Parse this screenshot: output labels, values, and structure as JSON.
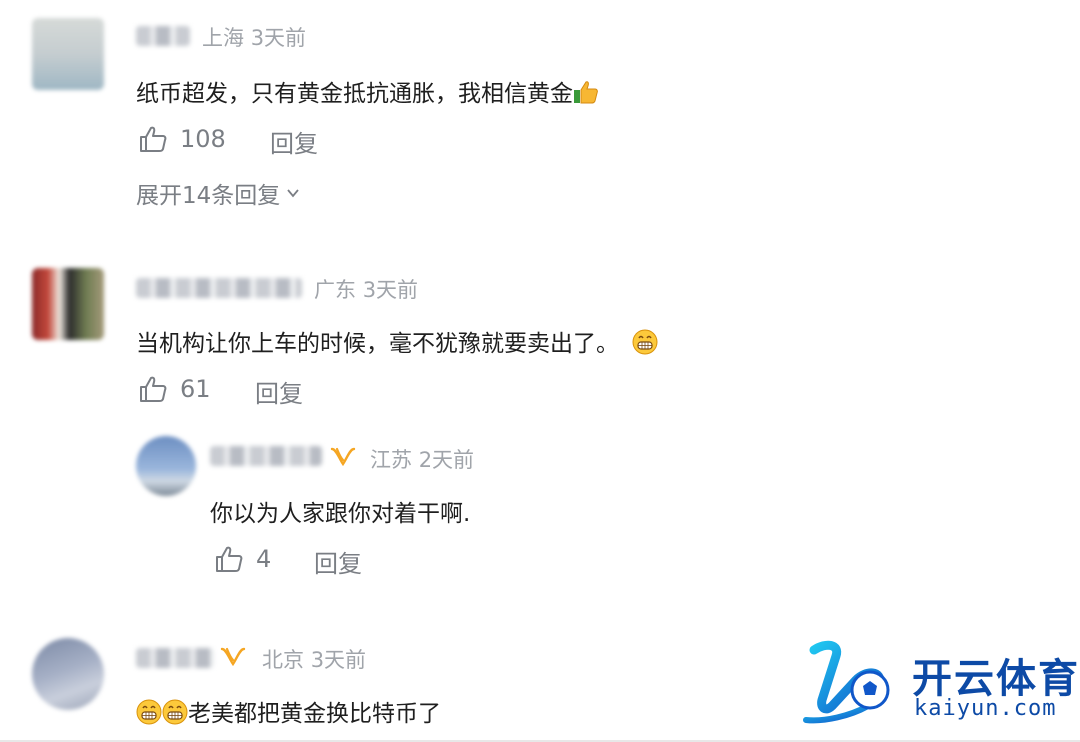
{
  "comments": [
    {
      "location": "上海",
      "time": "3天前",
      "text": "纸币超发，只有黄金抵抗通胀，我相信黄金",
      "likes": "108",
      "reply_label": "回复",
      "expand_label": "展开14条回复"
    },
    {
      "location": "广东",
      "time": "3天前",
      "text": "当机构让你上车的时候，毫不犹豫就要卖出了。",
      "likes": "61",
      "reply_label": "回复"
    },
    {
      "location": "江苏",
      "time": "2天前",
      "text": "你以为人家跟你对着干啊.",
      "likes": "4",
      "reply_label": "回复"
    },
    {
      "location": "北京",
      "time": "3天前",
      "text": "老美都把黄金换比特币了"
    }
  ],
  "watermark": {
    "cn": "开云体育",
    "en": "kaiyun.com"
  },
  "icons": [
    "thumbs-up-icon",
    "chevron-down-icon",
    "vip-badge-icon",
    "grin-emoji-icon",
    "thumbs-up-emoji-icon"
  ],
  "colors": {
    "meta": "#a0a4aa",
    "action": "#7a7e84",
    "vip": "#f5a623",
    "logo": "#0d4aa6"
  }
}
